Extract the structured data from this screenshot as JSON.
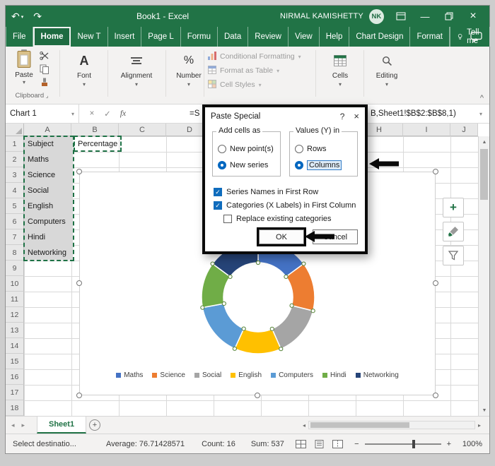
{
  "window": {
    "title": "Book1 - Excel",
    "user_name": "NIRMAL KAMISHETTY",
    "user_initials": "NK"
  },
  "icons": {
    "undo": "↶",
    "redo": "↷",
    "chevron_down": "▾",
    "check": "✓",
    "close": "×",
    "minimize": "—",
    "help": "?",
    "add_sheet": "+",
    "scroll_up": "▲",
    "scroll_down": "▼",
    "scroll_left": "◂",
    "scroll_right": "▸",
    "zoom_in": "+",
    "zoom_out": "−",
    "ribbon_collapse": "^",
    "chart_add": "+"
  },
  "ribbon": {
    "tabs": [
      {
        "label": "File"
      },
      {
        "label": "Home",
        "active": true
      },
      {
        "label": "New T"
      },
      {
        "label": "Insert"
      },
      {
        "label": "Page L"
      },
      {
        "label": "Formu"
      },
      {
        "label": "Data"
      },
      {
        "label": "Review"
      },
      {
        "label": "View"
      },
      {
        "label": "Help"
      },
      {
        "label": "Chart Design"
      },
      {
        "label": "Format"
      }
    ],
    "tell_me": "Tell me",
    "paste_label": "Paste",
    "clipboard_label": "Clipboard",
    "font_label": "Font",
    "font_symbol": "A",
    "alignment_label": "Alignment",
    "number_label": "Number",
    "number_symbol": "%",
    "styles_items": [
      "Conditional Formatting",
      "Format as Table",
      "Cell Styles"
    ],
    "cells_label": "Cells",
    "editing_label": "Editing"
  },
  "formula_bar": {
    "name_box": "Chart 1",
    "fx_label": "fx",
    "visible_left": "=S",
    "visible_right": "B,Sheet1!$B$2:$B$8,1)"
  },
  "dialog": {
    "title": "Paste Special",
    "help_glyph": "?",
    "close_glyph": "×",
    "groups": [
      {
        "label": "Add cells as",
        "options": [
          {
            "label": "New point(s)",
            "selected": false
          },
          {
            "label": "New series",
            "selected": true
          }
        ]
      },
      {
        "label": "Values (Y) in",
        "options": [
          {
            "label": "Rows",
            "selected": false
          },
          {
            "label": "Columns",
            "selected": true,
            "focused": true
          }
        ]
      }
    ],
    "checkboxes": [
      {
        "label": "Series Names in First Row",
        "checked": true
      },
      {
        "label": "Categories (X Labels) in First Column",
        "checked": true
      },
      {
        "label": "Replace existing categories",
        "checked": false,
        "indent": true
      }
    ],
    "ok_label": "OK",
    "cancel_label": "Cancel"
  },
  "sheet": {
    "name": "Sheet1",
    "columns": [
      "A",
      "B",
      "C",
      "D",
      "E",
      "F",
      "G",
      "H",
      "I",
      "J"
    ],
    "row_count": 18,
    "column_a_values": [
      "Subject",
      "Maths",
      "Science",
      "Social",
      "English",
      "Computers",
      "Hindi",
      "Networking"
    ],
    "cell_b1": "Percentage"
  },
  "chart_data": {
    "type": "pie",
    "subtype": "doughnut",
    "title": "",
    "categories": [
      "Maths",
      "Science",
      "Social",
      "English",
      "Computers",
      "Hindi",
      "Networking"
    ],
    "values": [
      80,
      75,
      78,
      72,
      82,
      70,
      80
    ],
    "colors": [
      "#4472C4",
      "#ED7D31",
      "#A5A5A5",
      "#FFC000",
      "#5B9BD5",
      "#70AD47",
      "#264478"
    ],
    "legend_position": "bottom"
  },
  "status_bar": {
    "mode": "Select destinatio...",
    "average": "Average: 76.71428571",
    "count": "Count: 16",
    "sum": "Sum: 537",
    "zoom": "100%"
  }
}
